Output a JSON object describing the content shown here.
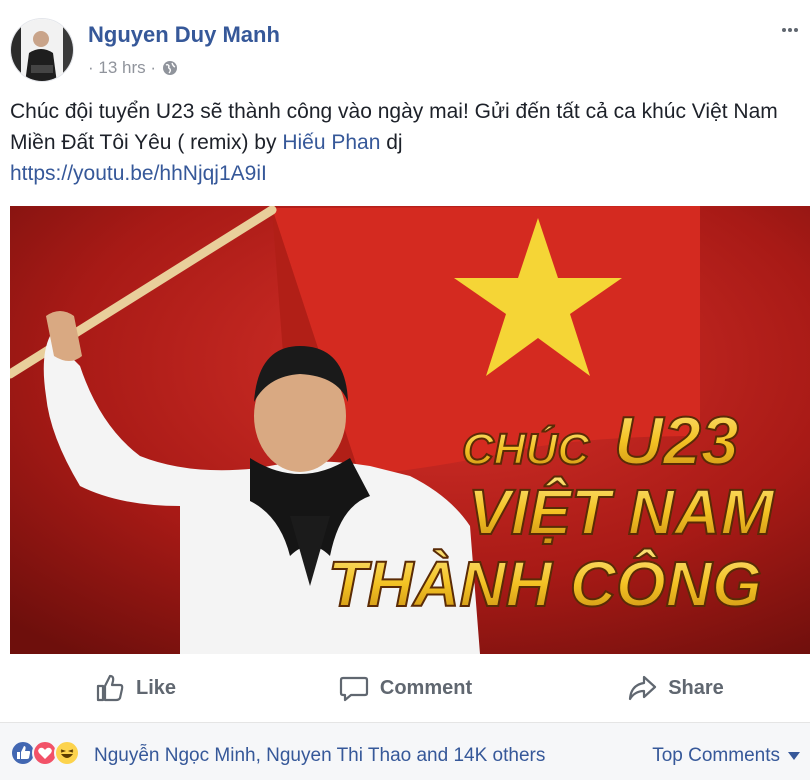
{
  "post": {
    "author": "Nguyen Duy Manh",
    "time": "· 13 hrs ·",
    "privacy_icon": "globe-icon",
    "text_part1": "Chúc đội tuyển U23 sẽ thành công vào ngày mai! Gửi đến tất cả ca khúc Việt Nam Miền Đất Tôi Yêu ( remix) by ",
    "mention": "Hiếu Phan",
    "text_part2": " dj",
    "link": "https://youtu.be/hhNjqj1A9iI"
  },
  "video": {
    "title_line1_a": "CHÚC",
    "title_line1_b": "U23",
    "title_line2": "VIỆT NAM",
    "title_line3": "THÀNH CÔNG",
    "colors": {
      "flag_red": "#c8221c",
      "star_yellow": "#f5d536",
      "text_gold": "#f3c224"
    }
  },
  "actions": {
    "like": "Like",
    "comment": "Comment",
    "share": "Share"
  },
  "reactions": {
    "names": "Nguyễn Ngọc Minh, Nguyen Thi Thao and 14K others",
    "top_comments": "Top Comments",
    "icons": [
      "like-reaction-icon",
      "love-reaction-icon",
      "haha-reaction-icon"
    ]
  },
  "colors": {
    "link": "#365899",
    "meta": "#90949c",
    "action": "#606770"
  }
}
